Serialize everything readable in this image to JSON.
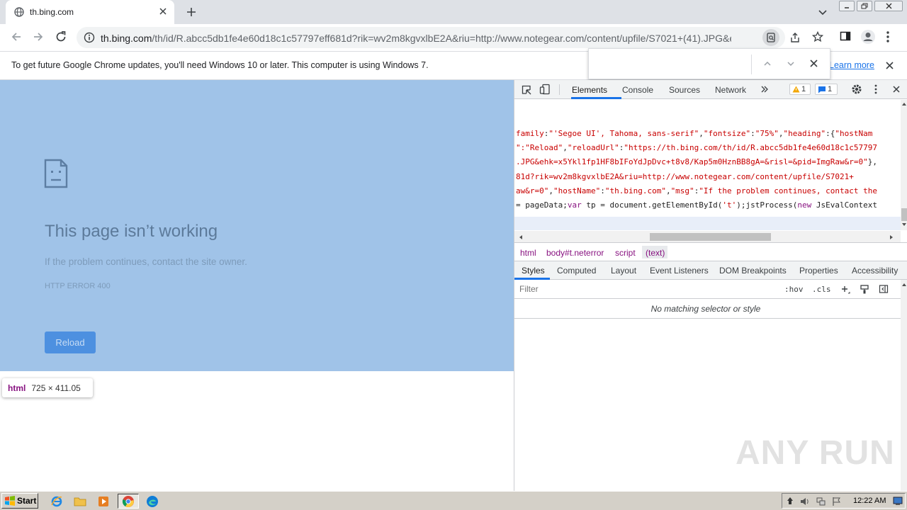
{
  "browser": {
    "tab": {
      "title": "th.bing.com"
    },
    "url": {
      "host": "th.bing.com",
      "path": "/th/id/R.abcc5db1fe4e60d18c1c57797eff681d?rik=wv2m8kgvxlbE2A&riu=http://www.notegear.com/content/upfile/S7021+(41).JPG&e..."
    },
    "infobar": {
      "message": "To get future Google Chrome updates, you'll need Windows 10 or later. This computer is using Windows 7.",
      "learn_more": "Learn more"
    }
  },
  "error_page": {
    "title": "This page isn’t working",
    "message": "If the problem continues, contact the site owner.",
    "code": "HTTP ERROR 400",
    "reload_label": "Reload",
    "inspect_tooltip": {
      "tag": "html",
      "dimensions": "725 × 411.05"
    },
    "overlay_color": "#a0c3e8"
  },
  "devtools": {
    "tabs": [
      "Elements",
      "Console",
      "Sources",
      "Network"
    ],
    "active_tab": "Elements",
    "warnings": "1",
    "messages": "1",
    "code_lines": [
      [
        [
          "s",
          "family"
        ],
        [
          "t",
          ":"
        ],
        [
          "s",
          "\"'Segoe UI', Tahoma, sans-serif\""
        ],
        [
          "t",
          ","
        ],
        [
          "s",
          "\"fontsize\""
        ],
        [
          "t",
          ":"
        ],
        [
          "s",
          "\"75%\""
        ],
        [
          "t",
          ","
        ],
        [
          "s",
          "\"heading\""
        ],
        [
          "t",
          ":{"
        ],
        [
          "s",
          "\"hostNam"
        ]
      ],
      [
        [
          "s",
          "\":\"Reload\""
        ],
        [
          "t",
          ","
        ],
        [
          "s",
          "\"reloadUrl\""
        ],
        [
          "t",
          ":"
        ],
        [
          "s",
          "\"https://th.bing.com/th/id/R.abcc5db1fe4e60d18c1c57797"
        ]
      ],
      [
        [
          "s",
          ".JPG&ehk=x5Ykl1fp1HF8bIFoYdJpDvc+t8v8/Kap5m0HznBB8gA=&risl=&pid=ImgRaw&r=0\""
        ],
        [
          "t",
          "},"
        ]
      ],
      [
        [
          "s",
          "81d?rik=wv2m8kgvxlbE2A&riu=http://www.notegear.com/content/upfile/S7021+"
        ]
      ],
      [
        [
          "s",
          "aw&r=0\""
        ],
        [
          "t",
          ","
        ],
        [
          "s",
          "\"hostName\""
        ],
        [
          "t",
          ":"
        ],
        [
          "s",
          "\"th.bing.com\""
        ],
        [
          "t",
          ","
        ],
        [
          "s",
          "\"msg\""
        ],
        [
          "t",
          ":"
        ],
        [
          "s",
          "\"If the problem continues, contact the"
        ]
      ],
      [
        [
          "t",
          "= pageData;"
        ],
        [
          "k",
          "var"
        ],
        [
          "t",
          " tp = document.getElementById("
        ],
        [
          "s",
          "'t'"
        ],
        [
          "t",
          ");jstProcess("
        ],
        [
          "k",
          "new"
        ],
        [
          "t",
          " JsEvalContext"
        ]
      ]
    ],
    "breadcrumbs": [
      {
        "label": "html",
        "color": "#881280"
      },
      {
        "label": "body#t.neterror",
        "color": "#881280"
      },
      {
        "label": "script",
        "color": "#881280"
      },
      {
        "label": "(text)",
        "color": "#881280"
      }
    ],
    "sub_tabs": [
      "Styles",
      "Computed",
      "Layout",
      "Event Listeners",
      "DOM Breakpoints",
      "Properties",
      "Accessibility"
    ],
    "filter_placeholder": "Filter",
    "hov": ":hov",
    "cls": ".cls",
    "no_match": "No matching selector or style"
  },
  "taskbar": {
    "start": "Start",
    "clock": "12:22 AM"
  },
  "watermark": "ANY RUN"
}
